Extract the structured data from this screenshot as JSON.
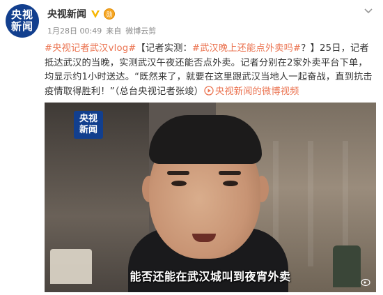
{
  "account": {
    "avatar_line1": "央视",
    "avatar_line2": "新闻",
    "name": "央视新闻",
    "medal_label": "勋"
  },
  "meta": {
    "time": "1月28日 00:49",
    "source_prefix": "来自",
    "source": "微博云剪"
  },
  "post": {
    "hashtag1": "#央视记者武汉vlog#",
    "bracket_open": "【",
    "label_intro": "记者实测：",
    "hashtag2": "#武汉晚上还能点外卖吗#",
    "bracket_close": "？】",
    "body": "25日，记者抵达武汉的当晚，实测武汉午夜还能否点外卖。记者分别在2家外卖平台下单，均显示约1小时送达。“既然来了，就要在这里跟武汉当地人一起奋战，直到抗击疫情取得胜利！”（总台央视记者张竣）",
    "video_link_icon": "play-circle-icon",
    "video_link": "央视新闻的微博视频"
  },
  "video": {
    "logo_line1": "央视",
    "logo_line2": "新闻",
    "subtitle": "能否还能在武汉城叫到夜宵外卖"
  },
  "colors": {
    "link": "#eb7350",
    "brand_blue": "#123f8e",
    "verified": "#f7b500"
  }
}
